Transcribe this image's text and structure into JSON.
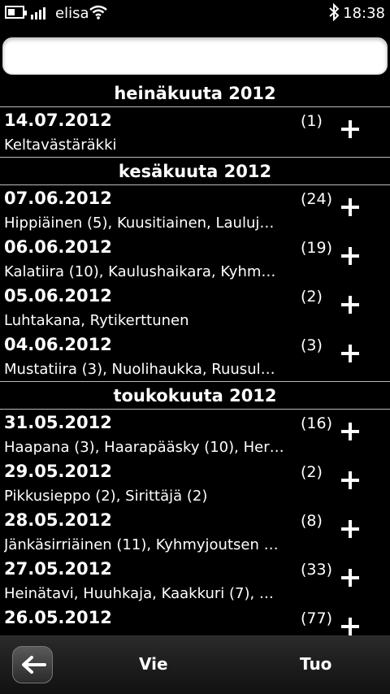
{
  "status_bar": {
    "carrier": "elisa",
    "time": "18:38",
    "battery_level": 0.35
  },
  "search": {
    "value": "",
    "placeholder": ""
  },
  "groups": [
    {
      "month": "heinäkuuta 2012",
      "entries": [
        {
          "date": "14.07.2012",
          "count": "(1)",
          "species": "Keltavästäräkki"
        }
      ]
    },
    {
      "month": "kesäkuuta 2012",
      "entries": [
        {
          "date": "07.06.2012",
          "count": "(24)",
          "species": "Hippiäinen (5), Kuusitiainen, Lauluj…"
        },
        {
          "date": "06.06.2012",
          "count": "(19)",
          "species": "Kalatiira (10), Kaulushaikara, Kyhm…"
        },
        {
          "date": "05.06.2012",
          "count": "(2)",
          "species": "Luhtakana, Rytikerttunen"
        },
        {
          "date": "04.06.2012",
          "count": "(3)",
          "species": "Mustatiira (3), Nuolihaukka, Ruusul…"
        }
      ]
    },
    {
      "month": "toukokuuta 2012",
      "entries": [
        {
          "date": "31.05.2012",
          "count": "(16)",
          "species": "Haapana (3), Haarapääsky (10), Her…"
        },
        {
          "date": "29.05.2012",
          "count": "(2)",
          "species": "Pikkusieppo (2), Sirittäjä (2)"
        },
        {
          "date": "28.05.2012",
          "count": "(8)",
          "species": "Jänkäsirriäinen (11), Kyhmyjoutsen …"
        },
        {
          "date": "27.05.2012",
          "count": "(33)",
          "species": "Heinätavi, Huuhkaja, Kaakkuri (7), …"
        },
        {
          "date": "26.05.2012",
          "count": "(77)",
          "species": ""
        }
      ]
    }
  ],
  "toolbar": {
    "export_label": "Vie",
    "import_label": "Tuo"
  },
  "icons": {
    "back": "back-arrow-icon",
    "add": "plus-icon"
  },
  "colors": {
    "background": "#000000",
    "text": "#ffffff",
    "separator": "#bbbbbb"
  }
}
